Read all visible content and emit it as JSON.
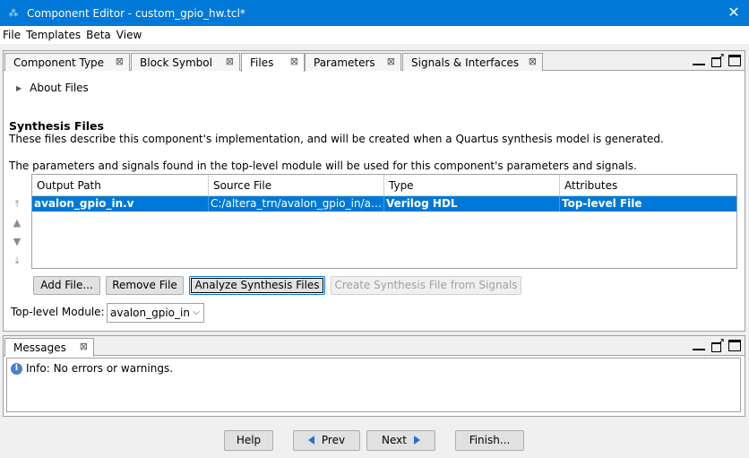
{
  "window": {
    "title": "Component Editor - custom_gpio_hw.tcl*",
    "close_glyph": "✕"
  },
  "menu": [
    "File",
    "Templates",
    "Beta",
    "View"
  ],
  "tabs": [
    {
      "label": "Component Type",
      "active": false
    },
    {
      "label": "Block Symbol",
      "active": false
    },
    {
      "label": "Files",
      "active": true
    },
    {
      "label": "Parameters",
      "active": false
    },
    {
      "label": "Signals & Interfaces",
      "active": false
    }
  ],
  "tab_close_glyph": "⊠",
  "about": {
    "label": "About Files"
  },
  "synthesis": {
    "title": "Synthesis Files",
    "desc1": "These files describe this component's implementation, and will be created when a Quartus synthesis model is generated.",
    "desc2": "The parameters and signals found in the top-level module will be used for this component's parameters and signals."
  },
  "table": {
    "headers": [
      "Output Path",
      "Source File",
      "Type",
      "Attributes"
    ],
    "rows": [
      {
        "output_path": "avalon_gpio_in.v",
        "source_file": "C:/altera_trn/avalon_gpio_in/av...",
        "type": "Verilog HDL",
        "attributes": "Top-level File",
        "selected": true
      }
    ]
  },
  "buttons": {
    "add_file": "Add File...",
    "remove_file": "Remove File",
    "analyze": "Analyze Synthesis Files",
    "create": "Create Synthesis File from Signals"
  },
  "top_level": {
    "label": "Top-level Module:",
    "value": "avalon_gpio_in"
  },
  "messages": {
    "tab_label": "Messages",
    "line": "Info: No errors or warnings."
  },
  "footer": {
    "help": "Help",
    "prev": "Prev",
    "next": "Next",
    "finish": "Finish..."
  },
  "icons": {
    "move_top": "move-top-icon",
    "move_up": "move-up-icon",
    "move_down": "move-down-icon",
    "move_bottom": "move-bottom-icon",
    "info": "info-icon"
  },
  "colors": {
    "titlebar": "#0078d7",
    "selection": "#0078d7",
    "arrow_blue": "#2a6fd6"
  }
}
